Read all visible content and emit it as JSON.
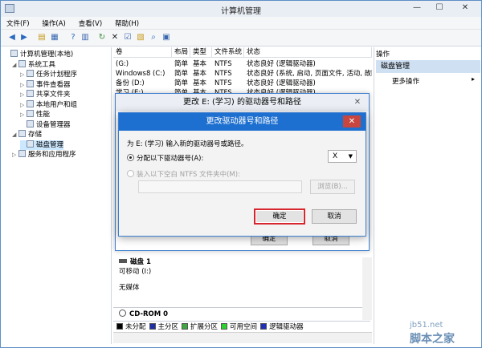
{
  "window": {
    "title": "计算机管理",
    "min": "—",
    "max": "☐",
    "close": "✕"
  },
  "menu": [
    "文件(F)",
    "操作(A)",
    "查看(V)",
    "帮助(H)"
  ],
  "tree": [
    {
      "label": "计算机管理(本地)",
      "level": 0,
      "arrow": "",
      "icon": "computer-icon"
    },
    {
      "label": "系统工具",
      "level": 1,
      "arrow": "◢",
      "icon": "tools-icon"
    },
    {
      "label": "任务计划程序",
      "level": 2,
      "arrow": "▷",
      "icon": "clock-icon"
    },
    {
      "label": "事件查看器",
      "level": 2,
      "arrow": "▷",
      "icon": "log-icon"
    },
    {
      "label": "共享文件夹",
      "level": 2,
      "arrow": "▷",
      "icon": "folder-icon"
    },
    {
      "label": "本地用户和组",
      "level": 2,
      "arrow": "▷",
      "icon": "users-icon"
    },
    {
      "label": "性能",
      "level": 2,
      "arrow": "▷",
      "icon": "performance-icon"
    },
    {
      "label": "设备管理器",
      "level": 2,
      "arrow": "",
      "icon": "device-icon"
    },
    {
      "label": "存储",
      "level": 1,
      "arrow": "◢",
      "icon": "storage-icon"
    },
    {
      "label": "磁盘管理",
      "level": 2,
      "arrow": "",
      "icon": "disk-icon",
      "selected": true
    },
    {
      "label": "服务和应用程序",
      "level": 1,
      "arrow": "▷",
      "icon": "services-icon"
    }
  ],
  "grid": {
    "headers": [
      "卷",
      "布局",
      "类型",
      "文件系统",
      "状态"
    ],
    "rows": [
      [
        "(G:)",
        "简单",
        "基本",
        "NTFS",
        "状态良好 (逻辑驱动器)"
      ],
      [
        "Windows8 (C:)",
        "简单",
        "基本",
        "NTFS",
        "状态良好 (系统, 启动, 页面文件, 活动, 故障"
      ],
      [
        "备份 (D:)",
        "简单",
        "基本",
        "NTFS",
        "状态良好 (逻辑驱动器)"
      ],
      [
        "学习 (E:)",
        "简单",
        "基本",
        "NTFS",
        "状态良好 (逻辑驱动器)"
      ]
    ]
  },
  "actions": {
    "header": "操作",
    "selected": "磁盘管理",
    "more": "更多操作",
    "arrow": "▸"
  },
  "lower": {
    "disk1_label": "磁盘 1",
    "disk1_type": "可移动 (I:)",
    "disk1_media": "无媒体",
    "cdrom": "CD-ROM 0"
  },
  "legend": [
    {
      "label": "未分配",
      "color": "#000000"
    },
    {
      "label": "主分区",
      "color": "#1f2fa8"
    },
    {
      "label": "扩展分区",
      "color": "#3fa73f"
    },
    {
      "label": "可用空间",
      "color": "#2ed22e"
    },
    {
      "label": "逻辑驱动器",
      "color": "#2030b8"
    }
  ],
  "dialog_outer": {
    "title": "更改 E: (学习) 的驱动器号和路径",
    "ok": "确定",
    "cancel": "取消",
    "close": "✕"
  },
  "dialog_inner": {
    "title": "更改驱动器号和路径",
    "close": "✕",
    "prompt": "为 E: (学习) 输入新的驱动器号或路径。",
    "option1": "分配以下驱动器号(A):",
    "drive_letter": "X",
    "option2": "装入以下空白 NTFS 文件夹中(M):",
    "browse": "浏览(B)...",
    "ok": "确定",
    "cancel": "取消"
  },
  "watermark": {
    "site": "jb51.net",
    "brand": "脚本之家"
  }
}
